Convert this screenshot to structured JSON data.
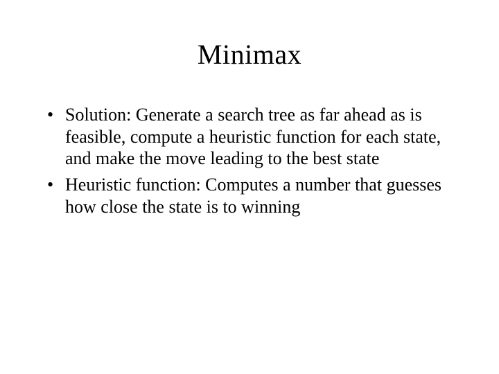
{
  "slide": {
    "title": "Minimax",
    "bullets": [
      "Solution:  Generate a search tree as far ahead as is feasible, compute a heuristic function for each state, and make the move leading to the best state",
      "Heuristic function: Computes a number that guesses how close the state is to winning"
    ]
  }
}
